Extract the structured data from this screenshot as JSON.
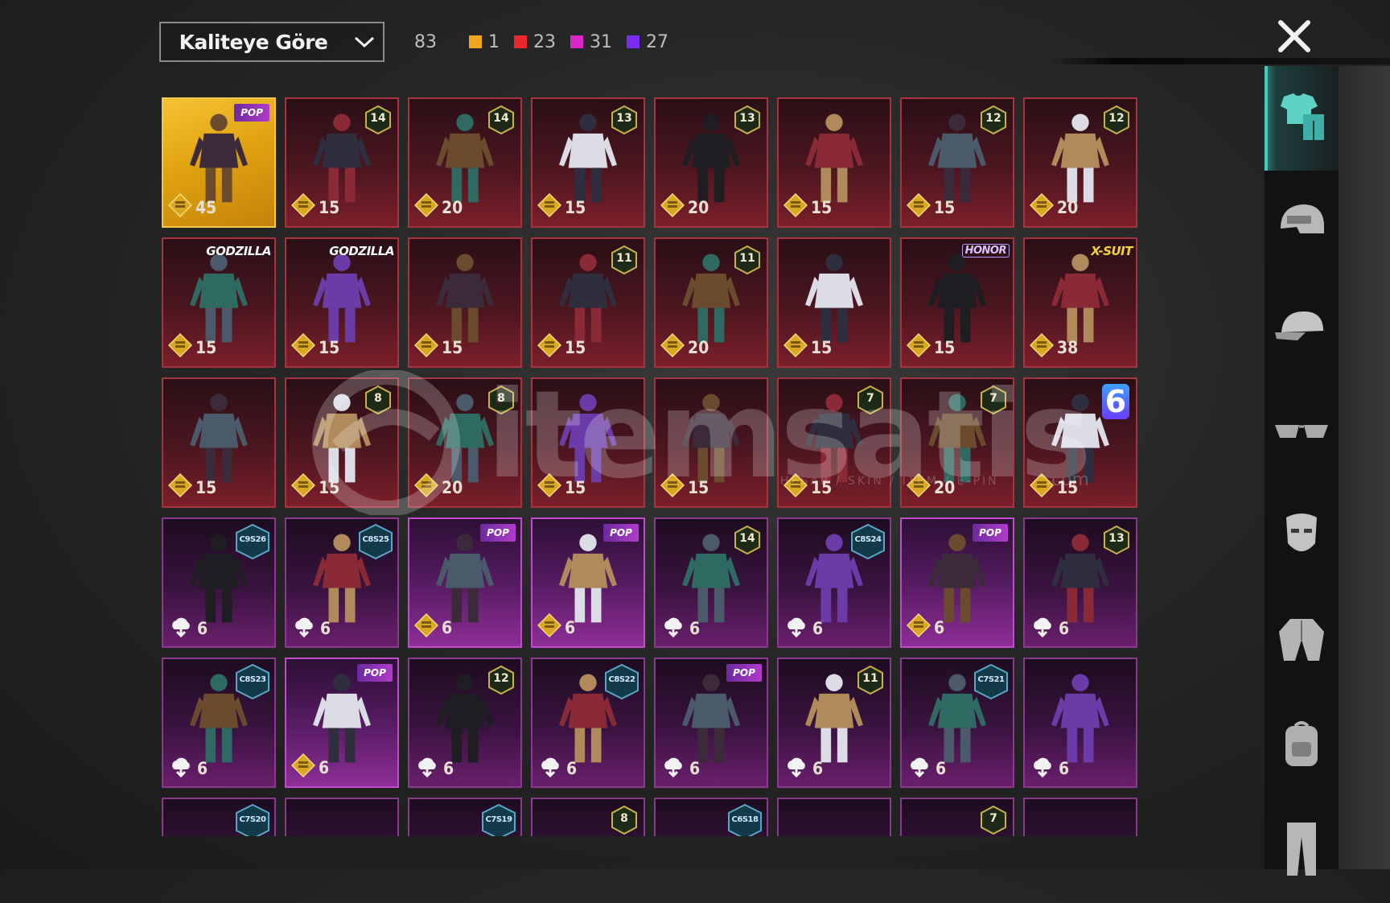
{
  "sort": {
    "label": "Kaliteye Göre"
  },
  "counts": {
    "total": "83",
    "groups": [
      {
        "color": "#f0a51c",
        "value": "1"
      },
      {
        "color": "#e8282c",
        "value": "23"
      },
      {
        "color": "#d828c8",
        "value": "31"
      },
      {
        "color": "#7a2cf0",
        "value": "27"
      }
    ]
  },
  "watermark": {
    "word": "itemsatis",
    "sub": "HESAP / SKIN / ITEM / E-PIN",
    "com": ".com"
  },
  "sidebar": {
    "tabs": [
      {
        "name": "outfit-icon",
        "active": true
      },
      {
        "name": "helmet-icon",
        "active": false
      },
      {
        "name": "cap-icon",
        "active": false
      },
      {
        "name": "glasses-icon",
        "active": false
      },
      {
        "name": "mask-icon",
        "active": false
      },
      {
        "name": "jacket-icon",
        "active": false
      },
      {
        "name": "backpack-icon",
        "active": false
      },
      {
        "name": "pants-icon",
        "active": false
      }
    ]
  },
  "items": [
    {
      "q": "gold",
      "cur": "coin",
      "price": "45",
      "badge": {
        "t": "pop",
        "v": "POP"
      }
    },
    {
      "q": "red",
      "cur": "coin",
      "price": "15",
      "badge": {
        "t": "num",
        "v": "14"
      }
    },
    {
      "q": "red",
      "cur": "coin",
      "price": "20",
      "badge": {
        "t": "num",
        "v": "14"
      }
    },
    {
      "q": "red",
      "cur": "coin",
      "price": "15",
      "badge": {
        "t": "num",
        "v": "13"
      }
    },
    {
      "q": "red",
      "cur": "coin",
      "price": "20",
      "badge": {
        "t": "num",
        "v": "13"
      }
    },
    {
      "q": "red",
      "cur": "coin",
      "price": "15",
      "badge": null
    },
    {
      "q": "red",
      "cur": "coin",
      "price": "15",
      "badge": {
        "t": "num",
        "v": "12"
      }
    },
    {
      "q": "red",
      "cur": "coin",
      "price": "20",
      "badge": {
        "t": "num",
        "v": "12"
      }
    },
    {
      "q": "red",
      "cur": "coin",
      "price": "15",
      "badge": {
        "t": "text",
        "v": "GODZILLA"
      }
    },
    {
      "q": "red",
      "cur": "coin",
      "price": "15",
      "badge": {
        "t": "text",
        "v": "GODZILLA"
      }
    },
    {
      "q": "red",
      "cur": "coin",
      "price": "15",
      "badge": null
    },
    {
      "q": "red",
      "cur": "coin",
      "price": "15",
      "badge": {
        "t": "num",
        "v": "11"
      }
    },
    {
      "q": "red",
      "cur": "coin",
      "price": "20",
      "badge": {
        "t": "num",
        "v": "11"
      }
    },
    {
      "q": "red",
      "cur": "coin",
      "price": "15",
      "badge": null
    },
    {
      "q": "red",
      "cur": "coin",
      "price": "15",
      "badge": {
        "t": "honor",
        "v": "HONOR"
      }
    },
    {
      "q": "red",
      "cur": "coin",
      "price": "38",
      "badge": {
        "t": "xsuit",
        "v": "X-SUIT"
      }
    },
    {
      "q": "red",
      "cur": "coin",
      "price": "15",
      "badge": null
    },
    {
      "q": "red",
      "cur": "coin",
      "price": "15",
      "badge": {
        "t": "num",
        "v": "8"
      }
    },
    {
      "q": "red",
      "cur": "coin",
      "price": "20",
      "badge": {
        "t": "num",
        "v": "8"
      }
    },
    {
      "q": "red",
      "cur": "coin",
      "price": "15",
      "badge": null
    },
    {
      "q": "red",
      "cur": "coin",
      "price": "15",
      "badge": null
    },
    {
      "q": "red",
      "cur": "coin",
      "price": "15",
      "badge": {
        "t": "num",
        "v": "7"
      }
    },
    {
      "q": "red",
      "cur": "coin",
      "price": "20",
      "badge": {
        "t": "num",
        "v": "7"
      }
    },
    {
      "q": "red",
      "cur": "coin",
      "price": "15",
      "badge": {
        "t": "six",
        "v": "6"
      }
    },
    {
      "q": "purple",
      "cur": "cloud",
      "price": "6",
      "badge": {
        "t": "hex",
        "v": "C9S26"
      }
    },
    {
      "q": "purple",
      "cur": "cloud",
      "price": "6",
      "badge": {
        "t": "hex",
        "v": "C8S25"
      }
    },
    {
      "q": "purple bright",
      "cur": "coin",
      "price": "6",
      "badge": {
        "t": "pop",
        "v": "POP"
      }
    },
    {
      "q": "purple bright",
      "cur": "coin",
      "price": "6",
      "badge": {
        "t": "pop",
        "v": "POP"
      }
    },
    {
      "q": "purple",
      "cur": "cloud",
      "price": "6",
      "badge": {
        "t": "num",
        "v": "14"
      }
    },
    {
      "q": "purple",
      "cur": "cloud",
      "price": "6",
      "badge": {
        "t": "hex",
        "v": "C8S24"
      }
    },
    {
      "q": "purple bright",
      "cur": "coin",
      "price": "6",
      "badge": {
        "t": "pop",
        "v": "POP"
      }
    },
    {
      "q": "purple",
      "cur": "cloud",
      "price": "6",
      "badge": {
        "t": "num",
        "v": "13"
      }
    },
    {
      "q": "purple",
      "cur": "cloud",
      "price": "6",
      "badge": {
        "t": "hex",
        "v": "C8S23"
      }
    },
    {
      "q": "purple bright",
      "cur": "coin",
      "price": "6",
      "badge": {
        "t": "pop",
        "v": "POP"
      }
    },
    {
      "q": "purple",
      "cur": "cloud",
      "price": "6",
      "badge": {
        "t": "num",
        "v": "12"
      }
    },
    {
      "q": "purple",
      "cur": "cloud",
      "price": "6",
      "badge": {
        "t": "hex",
        "v": "C8S22"
      }
    },
    {
      "q": "purple",
      "cur": "cloud",
      "price": "6",
      "badge": {
        "t": "pop",
        "v": "POP"
      }
    },
    {
      "q": "purple",
      "cur": "cloud",
      "price": "6",
      "badge": {
        "t": "num",
        "v": "11"
      }
    },
    {
      "q": "purple",
      "cur": "cloud",
      "price": "6",
      "badge": {
        "t": "hex",
        "v": "C7S21"
      }
    },
    {
      "q": "purple",
      "cur": "cloud",
      "price": "6",
      "badge": null
    },
    {
      "q": "purple",
      "cur": "none",
      "price": "",
      "badge": {
        "t": "hex",
        "v": "C7S20"
      }
    },
    {
      "q": "purple",
      "cur": "none",
      "price": "",
      "badge": null
    },
    {
      "q": "purple",
      "cur": "none",
      "price": "",
      "badge": {
        "t": "hex",
        "v": "C7S19"
      }
    },
    {
      "q": "purple",
      "cur": "none",
      "price": "",
      "badge": {
        "t": "num",
        "v": "8"
      }
    },
    {
      "q": "purple",
      "cur": "none",
      "price": "",
      "badge": {
        "t": "hex",
        "v": "C6S18"
      }
    },
    {
      "q": "purple",
      "cur": "none",
      "price": "",
      "badge": null
    },
    {
      "q": "purple",
      "cur": "none",
      "price": "",
      "badge": {
        "t": "num",
        "v": "7"
      }
    },
    {
      "q": "purple",
      "cur": "none",
      "price": "",
      "badge": null
    }
  ]
}
